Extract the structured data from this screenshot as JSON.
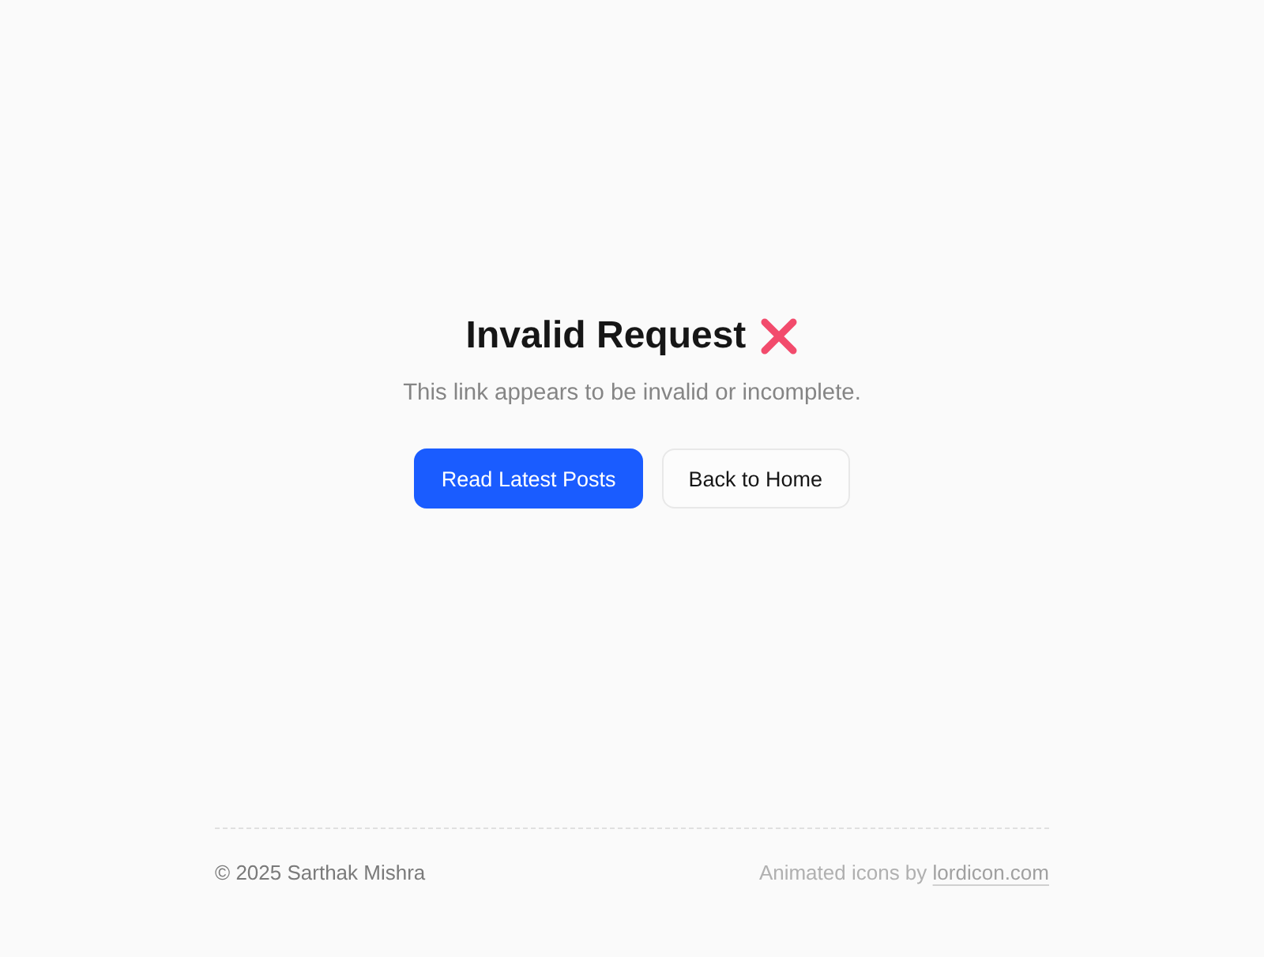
{
  "heading": {
    "title": "Invalid Request"
  },
  "message": "This link appears to be invalid or incomplete.",
  "buttons": [
    {
      "label": "Read Latest Posts",
      "kind": "primary"
    },
    {
      "label": "Back to Home",
      "kind": "secondary"
    }
  ],
  "footer": {
    "copyright": "© 2025 Sarthak Mishra",
    "credit": "Animated icons by",
    "link": "lordicon.com"
  }
}
